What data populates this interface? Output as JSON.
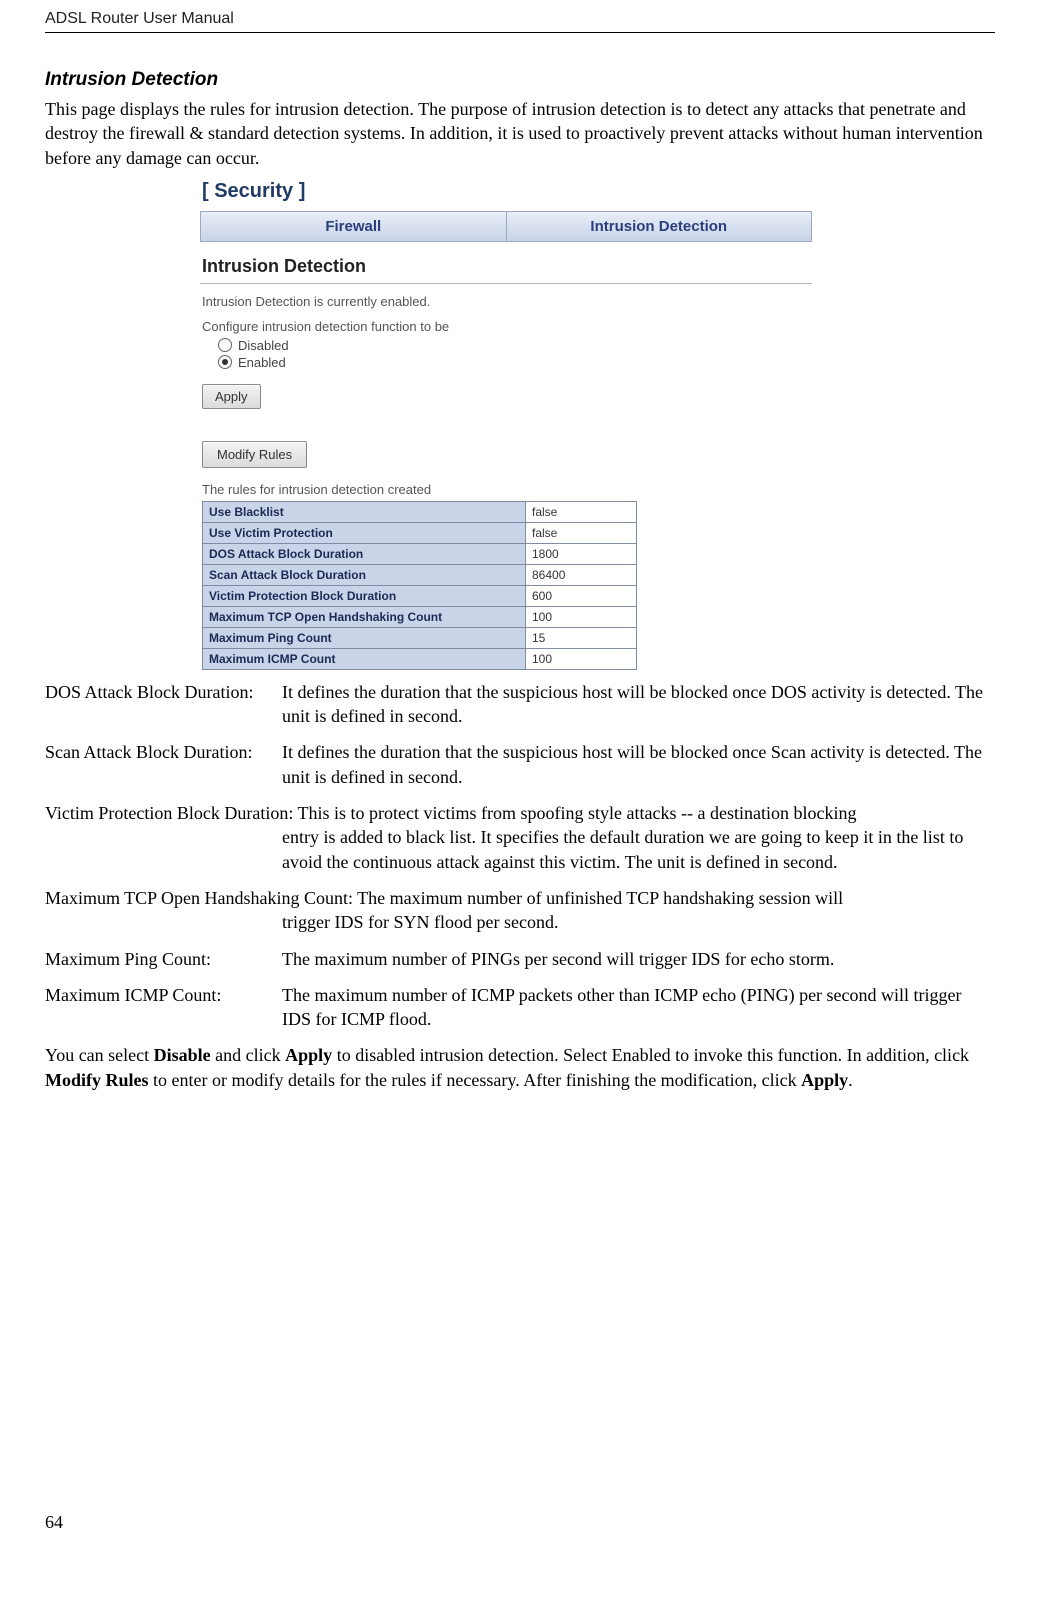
{
  "header": {
    "running": "ADSL Router User Manual"
  },
  "section": {
    "heading": "Intrusion Detection",
    "intro": "This page displays the rules for intrusion detection. The purpose of intrusion detection is to detect any attacks that penetrate and destroy the firewall & standard detection systems. In addition, it is used to proactively prevent attacks without human intervention before any damage can occur."
  },
  "screenshot": {
    "title": "[ Security ]",
    "tabs": {
      "firewall": "Firewall",
      "intrusion": "Intrusion Detection"
    },
    "subheading": "Intrusion Detection",
    "status_text": "Intrusion Detection is currently enabled.",
    "config_prompt": "Configure intrusion detection function to be",
    "radio_disabled": "Disabled",
    "radio_enabled": "Enabled",
    "apply_label": "Apply",
    "modify_label": "Modify Rules",
    "rules_caption": "The rules for intrusion detection created",
    "rules": [
      {
        "k": "Use Blacklist",
        "v": "false"
      },
      {
        "k": "Use Victim Protection",
        "v": "false"
      },
      {
        "k": "DOS Attack Block Duration",
        "v": "1800"
      },
      {
        "k": "Scan Attack Block Duration",
        "v": "86400"
      },
      {
        "k": "Victim Protection Block Duration",
        "v": "600"
      },
      {
        "k": "Maximum TCP Open Handshaking Count",
        "v": "100"
      },
      {
        "k": "Maximum Ping Count",
        "v": "15"
      },
      {
        "k": "Maximum ICMP Count",
        "v": "100"
      }
    ]
  },
  "defs": {
    "dos_term": "DOS Attack Block Duration:",
    "dos_desc": "It defines the duration that the suspicious host will be blocked once DOS activity is detected. The unit is defined in second.",
    "scan_term": "Scan Attack Block Duration:",
    "scan_desc": "It defines the duration that the suspicious host will be blocked once Scan activity is detected. The unit is defined in second.",
    "victim_first": "Victim Protection Block Duration: This is to protect victims from spoofing style attacks -- a destination blocking",
    "victim_cont": "entry is added to black list. It specifies the default duration we are going to keep it in the list to avoid the continuous attack against this victim. The unit is defined in second.",
    "tcp_first": "Maximum TCP Open Handshaking Count: The maximum number of unfinished TCP handshaking session will",
    "tcp_cont": "trigger IDS for SYN flood per second.",
    "ping_term": "Maximum Ping Count:",
    "ping_desc": "The maximum number of PINGs per second will trigger IDS for echo storm.",
    "icmp_term": "Maximum ICMP Count:",
    "icmp_desc": "The maximum number of ICMP packets other than ICMP echo (PING) per second will trigger IDS for ICMP flood."
  },
  "closing": {
    "p1a": "You can select ",
    "b1": "Disable",
    "p1b": " and click ",
    "b2": "Apply",
    "p1c": " to disabled intrusion detection. Select Enabled to invoke this function. In addition, click ",
    "b3": "Modify Rules",
    "p1d": " to enter or modify details for the rules if necessary. After finishing the modification, click ",
    "b4": "Apply",
    "p1e": "."
  },
  "page_number": "64"
}
